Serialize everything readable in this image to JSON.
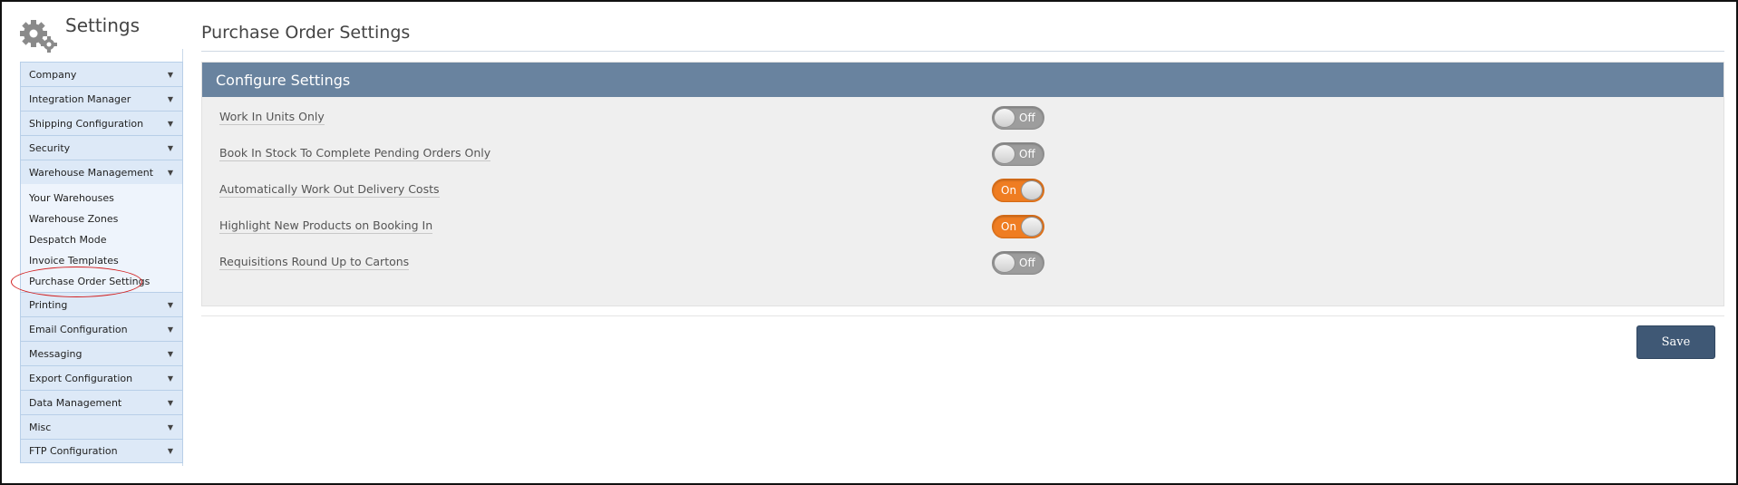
{
  "app": {
    "title": "Settings",
    "icon": "gears-icon"
  },
  "sidebar": {
    "top_items": [
      {
        "label": "Company"
      },
      {
        "label": "Integration Manager"
      },
      {
        "label": "Shipping Configuration"
      },
      {
        "label": "Security"
      },
      {
        "label": "Warehouse Management"
      }
    ],
    "submenu": [
      {
        "label": "Your Warehouses"
      },
      {
        "label": "Warehouse Zones"
      },
      {
        "label": "Despatch Mode"
      },
      {
        "label": "Invoice Templates"
      },
      {
        "label": "Purchase Order Settings"
      }
    ],
    "bottom_items": [
      {
        "label": "Printing"
      },
      {
        "label": "Email Configuration"
      },
      {
        "label": "Messaging"
      },
      {
        "label": "Export Configuration"
      },
      {
        "label": "Data Management"
      },
      {
        "label": "Misc"
      },
      {
        "label": "FTP Configuration"
      }
    ],
    "highlight_color": "#d21f1f"
  },
  "main": {
    "page_title": "Purchase Order Settings",
    "panel_title": "Configure Settings",
    "settings": [
      {
        "label": "Work In Units Only",
        "state": "Off"
      },
      {
        "label": "Book In Stock To Complete Pending Orders Only",
        "state": "Off"
      },
      {
        "label": "Automatically Work Out Delivery Costs",
        "state": "On"
      },
      {
        "label": "Highlight New Products on Booking In",
        "state": "On"
      },
      {
        "label": "Requisitions Round Up to Cartons",
        "state": "Off"
      }
    ],
    "save_label": "Save"
  },
  "colors": {
    "panel_header": "#69839f",
    "toggle_on": "#ef7d22",
    "toggle_off": "#9d9d9d",
    "save_button": "#3f5875",
    "menu_bg": "#dde9f7"
  }
}
